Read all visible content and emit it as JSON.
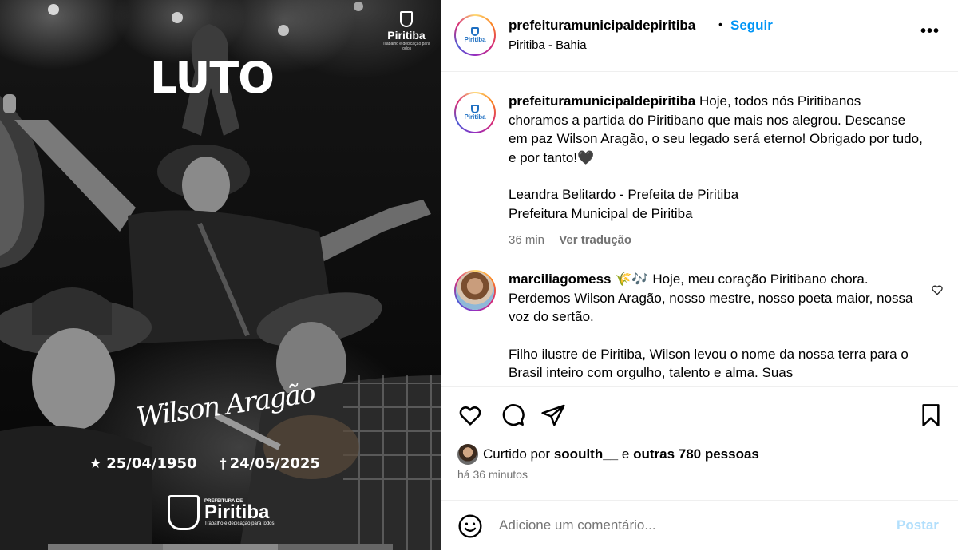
{
  "image": {
    "top_logo": {
      "name": "Piritiba",
      "tagline": "Trabalho e dedicação para todos"
    },
    "headline": "LUTO",
    "signature": "Wilson Aragão",
    "birth_date": "25/04/1950",
    "death_date": "24/05/2025",
    "bottom_logo": {
      "prefix": "PREFEITURA DE",
      "name": "Piritiba",
      "tagline": "Trabalho e dedicação para todos"
    },
    "carousel_count": 3
  },
  "header": {
    "username": "prefeituramunicipaldepiritiba",
    "separator": "•",
    "follow_label": "Seguir",
    "location": "Piritiba - Bahia",
    "more_icon": "more-horizontal-icon",
    "avatar_text": "Piritiba"
  },
  "caption": {
    "username": "prefeituramunicipaldepiritiba",
    "text": "Hoje, todos nós Piritibanos choramos a partida do Piritibano que mais nos alegrou. Descanse em paz Wilson Aragão, o seu legado será eterno! Obrigado por tudo, e por tanto!🖤",
    "signoff_line1": "Leandra Belitardo - Prefeita de Piritiba",
    "signoff_line2": "Prefeitura Municipal de Piritiba",
    "time": "36 min",
    "translate_label": "Ver tradução"
  },
  "comment": {
    "username": "marciliagomess",
    "emoji": "🌾🎶",
    "text": "Hoje, meu coração Piritibano chora. Perdemos Wilson Aragão, nosso mestre, nosso poeta maior, nossa voz do sertão.",
    "text2": "Filho ilustre de Piritiba, Wilson levou o nome da nossa terra para o Brasil inteiro com orgulho, talento e alma. Suas"
  },
  "likes": {
    "prefix": "Curtido por",
    "user": "sooulth__",
    "connector": "e",
    "others": "outras 780 pessoas"
  },
  "posted_ago": "há 36 minutos",
  "add_comment": {
    "placeholder": "Adicione um comentário...",
    "post_label": "Postar"
  },
  "colors": {
    "link_blue": "#0095f6",
    "post_disabled": "#b2dffc",
    "muted": "#737373"
  }
}
